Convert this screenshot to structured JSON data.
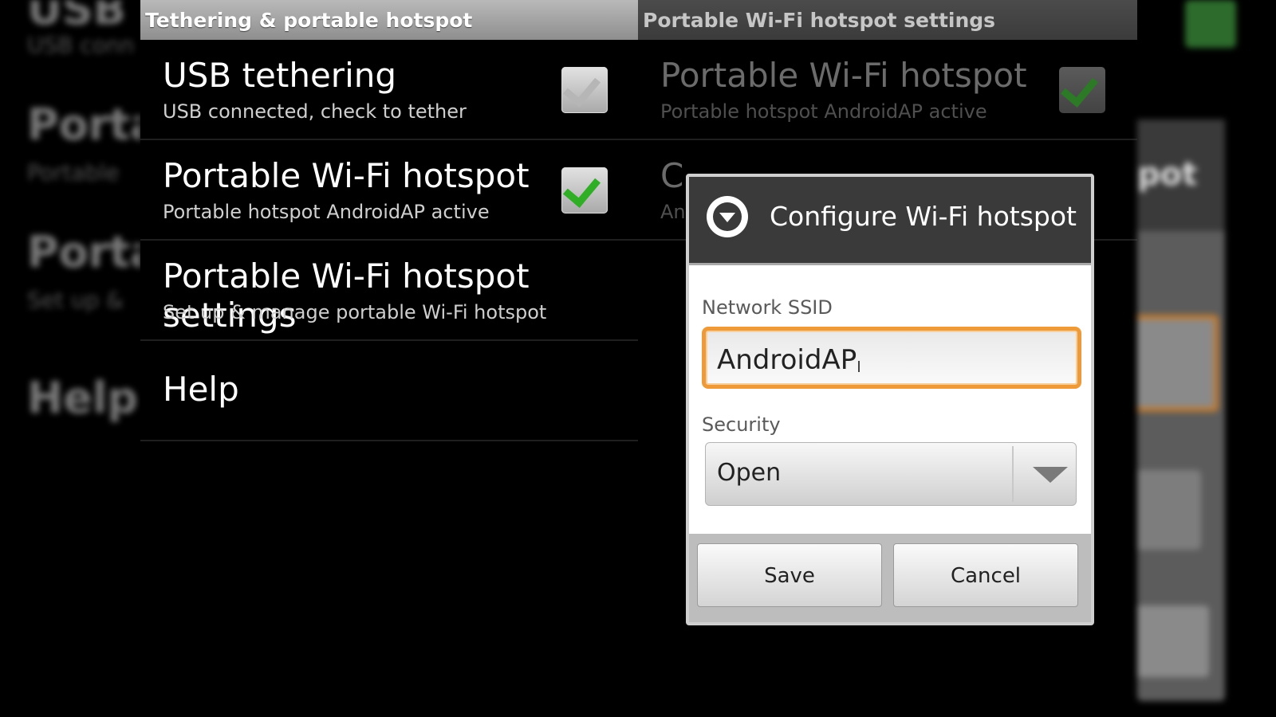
{
  "background_left": {
    "top_fragment": "USB t",
    "sub_fragment": "USB conn",
    "portal_1": "Portal",
    "portal_1_sub": "Portable",
    "portal_2": "Portal",
    "portal_2_sub": "Set up &",
    "help": "Help"
  },
  "background_right": {
    "hotspot_fragment": "pot"
  },
  "left_panel": {
    "header": "Tethering & portable hotspot",
    "items": [
      {
        "title": "USB tethering",
        "summary": "USB connected, check to tether",
        "checked": false
      },
      {
        "title": "Portable Wi-Fi hotspot",
        "summary": "Portable hotspot AndroidAP active",
        "checked": true
      },
      {
        "title": "Portable Wi-Fi hotspot settings",
        "summary": "Set up & manage portable Wi-Fi hotspot"
      },
      {
        "title": "Help"
      }
    ]
  },
  "right_panel": {
    "header": "Portable Wi-Fi hotspot settings",
    "items": [
      {
        "title": "Portable Wi-Fi hotspot",
        "summary": "Portable hotspot AndroidAP active",
        "checked": true
      },
      {
        "title": "C",
        "summary": "An"
      }
    ]
  },
  "dialog": {
    "icon": "chevron-down-circle-icon",
    "title": "Configure Wi-Fi hotspot",
    "ssid_label": "Network SSID",
    "ssid_value": "AndroidAP",
    "security_label": "Security",
    "security_value": "Open",
    "save_label": "Save",
    "cancel_label": "Cancel"
  },
  "colors": {
    "focus_border": "#ee9a38",
    "check_green": "#2fae26"
  }
}
